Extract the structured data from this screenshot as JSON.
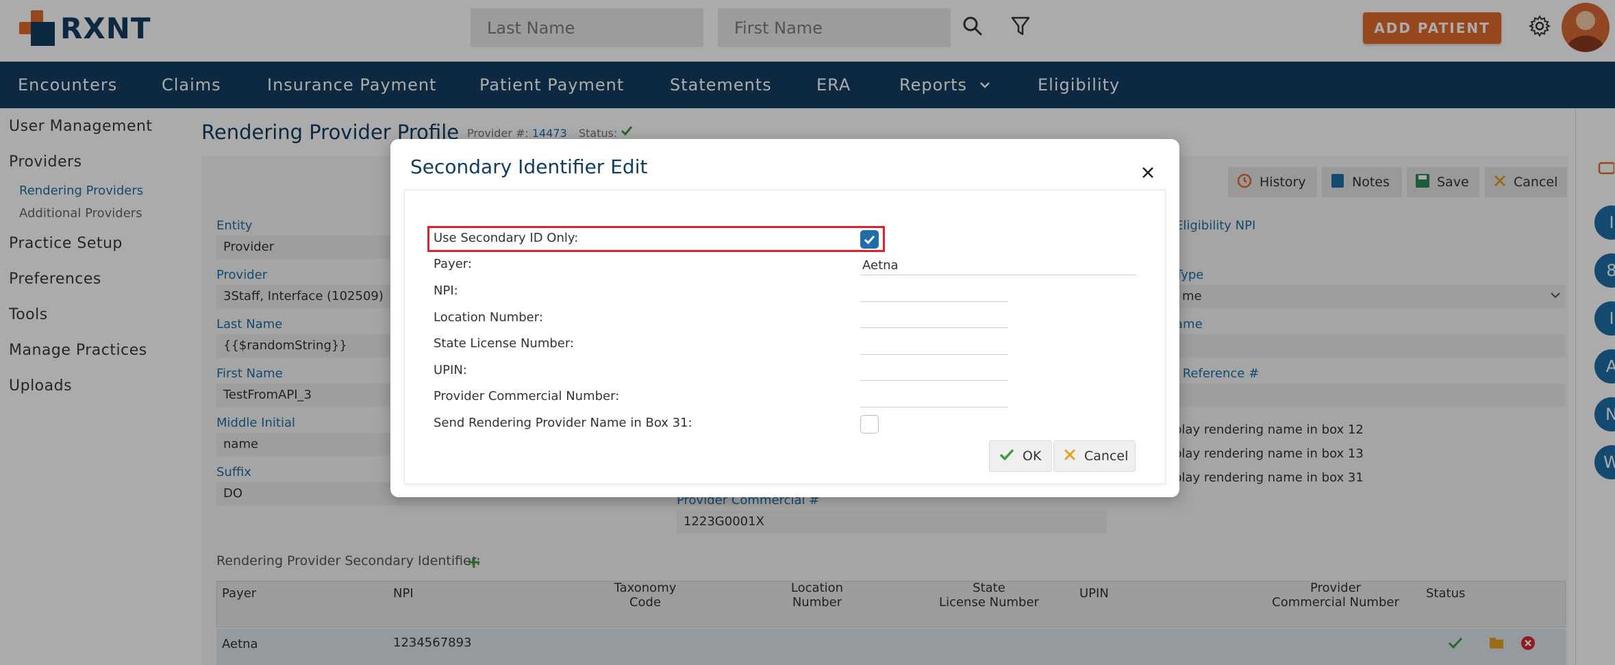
{
  "header": {
    "brand": "RXNT",
    "last_name_placeholder": "Last Name",
    "first_name_placeholder": "First Name",
    "add_patient_label": "ADD PATIENT"
  },
  "nav": {
    "items": [
      "Encounters",
      "Claims",
      "Insurance Payment",
      "Patient Payment",
      "Statements",
      "ERA",
      "Reports",
      "Eligibility"
    ]
  },
  "sidebar": {
    "user_management": "User Management",
    "providers": "Providers",
    "rendering_providers": "Rendering Providers",
    "additional_providers": "Additional Providers",
    "practice_setup": "Practice Setup",
    "preferences": "Preferences",
    "tools": "Tools",
    "manage_practices": "Manage Practices",
    "uploads": "Uploads"
  },
  "profile": {
    "title": "Rendering Provider Profile",
    "provider_num_label": "Provider #:",
    "provider_num": "14473",
    "status_label": "Status:",
    "toolbar": {
      "history": "History",
      "notes": "Notes",
      "save": "Save",
      "cancel": "Cancel"
    },
    "fields": {
      "entity_label": "Entity",
      "entity_value": "Provider",
      "provider_label": "Provider",
      "provider_value": "3Staff, Interface  (102509)",
      "last_name_label": "Last Name",
      "last_name_value": "{{$randomString}}",
      "first_name_label": "First Name",
      "first_name_value": "TestFromAPI_3",
      "middle_initial_label": "Middle Initial",
      "middle_initial_value": "name",
      "suffix_label": "Suffix",
      "suffix_value": "DO",
      "provider_commercial_label": "Provider Commercial #",
      "provider_commercial_value": "1223G0001X",
      "eligibility_npi_label": "Eligibility NPI",
      "type_label": "Type",
      "type_value": "me",
      "name_label": "ame",
      "reference_label": "l Reference #"
    },
    "right_checks": [
      "play rendering name in box 12",
      "play rendering name in box 13",
      "play rendering name in box 31"
    ],
    "secondary_label": "Rendering Provider Secondary Identifier:",
    "table": {
      "headers": [
        "Payer",
        "NPI",
        "Taxonomy\nCode",
        "Location\nNumber",
        "State\nLicense Number",
        "UPIN",
        "Provider\nCommercial Number",
        "Status"
      ],
      "rows": [
        {
          "payer": "Aetna",
          "npi": "1234567893"
        }
      ]
    }
  },
  "right_rail": {
    "circles": [
      "I",
      "8",
      "I",
      "A",
      "N",
      "W"
    ]
  },
  "modal": {
    "title": "Secondary Identifier Edit",
    "use_secondary_label": "Use Secondary ID Only:",
    "use_secondary_checked": true,
    "payer_label": "Payer:",
    "payer_value": "Aetna",
    "npi_label": "NPI:",
    "location_label": "Location Number:",
    "state_license_label": "State License Number:",
    "upin_label": "UPIN:",
    "provider_commercial_label": "Provider Commercial Number:",
    "send_name_label": "Send Rendering Provider Name in Box 31:",
    "send_name_checked": false,
    "ok_label": "OK",
    "cancel_label": "Cancel"
  },
  "colors": {
    "navy": "#123e61",
    "orange": "#e16a2a",
    "highlight": "#e0202a",
    "check_blue": "#1f6ea8"
  }
}
